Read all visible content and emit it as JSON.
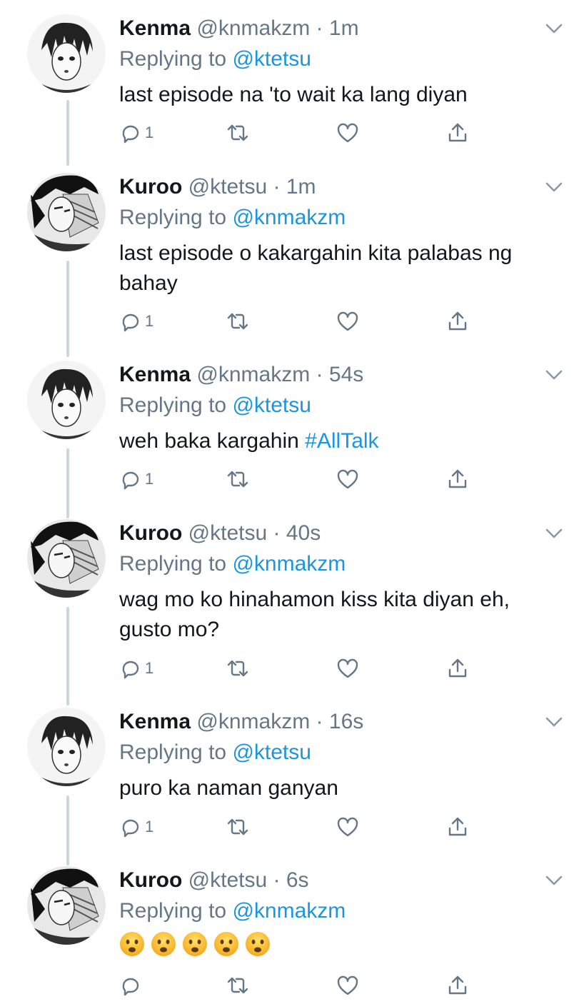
{
  "tweets": [
    {
      "name": "Kenma",
      "handle": "@knmakzm",
      "time": "1m",
      "reply_prefix": "Replying to ",
      "reply_to": "@ktetsu",
      "lines": [
        "last episode na 'to wait ka lang diyan"
      ],
      "hashtag": "",
      "reply_count": "1",
      "avatar": "kenma"
    },
    {
      "name": "Kuroo",
      "handle": "@ktetsu",
      "time": "1m",
      "reply_prefix": "Replying to ",
      "reply_to": "@knmakzm",
      "lines": [
        "last episode o kakargahin kita palabas ng",
        "bahay"
      ],
      "hashtag": "",
      "reply_count": "1",
      "avatar": "kuroo"
    },
    {
      "name": "Kenma",
      "handle": "@knmakzm",
      "time": "54s",
      "reply_prefix": "Replying to ",
      "reply_to": "@ktetsu",
      "lines": [
        "weh baka kargahin "
      ],
      "hashtag": "#AllTalk",
      "reply_count": "1",
      "avatar": "kenma"
    },
    {
      "name": "Kuroo",
      "handle": "@ktetsu",
      "time": "40s",
      "reply_prefix": "Replying to ",
      "reply_to": "@knmakzm",
      "lines": [
        "wag mo ko hinahamon kiss kita diyan eh,",
        "gusto mo?"
      ],
      "hashtag": "",
      "reply_count": "1",
      "avatar": "kuroo"
    },
    {
      "name": "Kenma",
      "handle": "@knmakzm",
      "time": "16s",
      "reply_prefix": "Replying to ",
      "reply_to": "@ktetsu",
      "lines": [
        "puro ka naman ganyan"
      ],
      "hashtag": "",
      "reply_count": "1",
      "avatar": "kenma"
    },
    {
      "name": "Kuroo",
      "handle": "@ktetsu",
      "time": "6s",
      "reply_prefix": "Replying to ",
      "reply_to": "@knmakzm",
      "lines": [],
      "emojis": [
        "frowning-face-emoji",
        "frowning-face-emoji",
        "frowning-face-emoji",
        "frowning-face-emoji",
        "frowning-face-emoji"
      ],
      "hashtag": "",
      "reply_count": "",
      "avatar": "kuroo"
    }
  ],
  "separator_dot": "·",
  "colors": {
    "link": "#1b95e0",
    "muted": "#657786",
    "text": "#14171a",
    "thread_line": "#ccd6dd"
  },
  "icons": {
    "reply": "reply-icon",
    "retweet": "retweet-icon",
    "like": "heart-icon",
    "share": "share-icon",
    "menu": "chevron-down-icon"
  }
}
